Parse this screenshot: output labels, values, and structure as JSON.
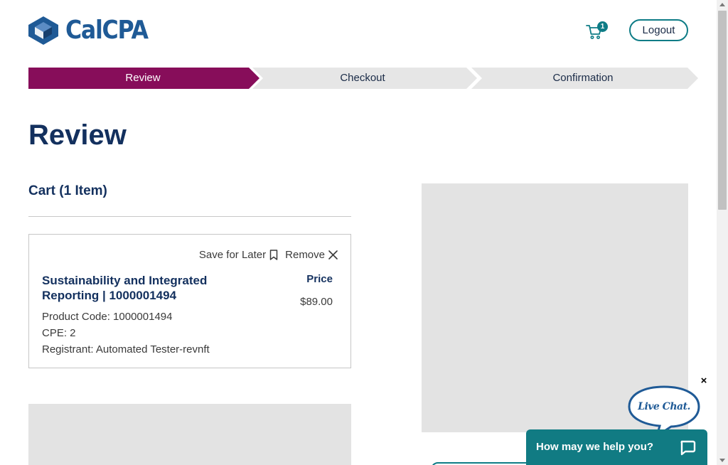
{
  "brand": {
    "name": "CalCPA",
    "accent": "#0e7c86",
    "primary": "#13305e",
    "step_active": "#870d5a"
  },
  "header": {
    "cart_icon": "shopping-cart-icon",
    "cart_count": "1",
    "logout_label": "Logout"
  },
  "steps": [
    {
      "label": "Review",
      "active": true
    },
    {
      "label": "Checkout",
      "active": false
    },
    {
      "label": "Confirmation",
      "active": false
    }
  ],
  "page": {
    "title": "Review"
  },
  "cart": {
    "heading": "Cart (1 Item)",
    "items": [
      {
        "save_for_later_label": "Save for Later",
        "save_icon": "bookmark-icon",
        "remove_label": "Remove",
        "remove_icon": "close-icon",
        "title": "Sustainability and Integrated Reporting | 1000001494",
        "price_label": "Price",
        "price": "$89.00",
        "product_code": "Product Code: 1000001494",
        "cpe": "CPE: 2",
        "registrant": "Registrant: Automated Tester-revnft"
      }
    ]
  },
  "chat": {
    "close_label": "×",
    "bubble_text": "Live Chat.",
    "bar_text": "How may we help you?",
    "bar_icon": "chat-bubble-icon"
  }
}
